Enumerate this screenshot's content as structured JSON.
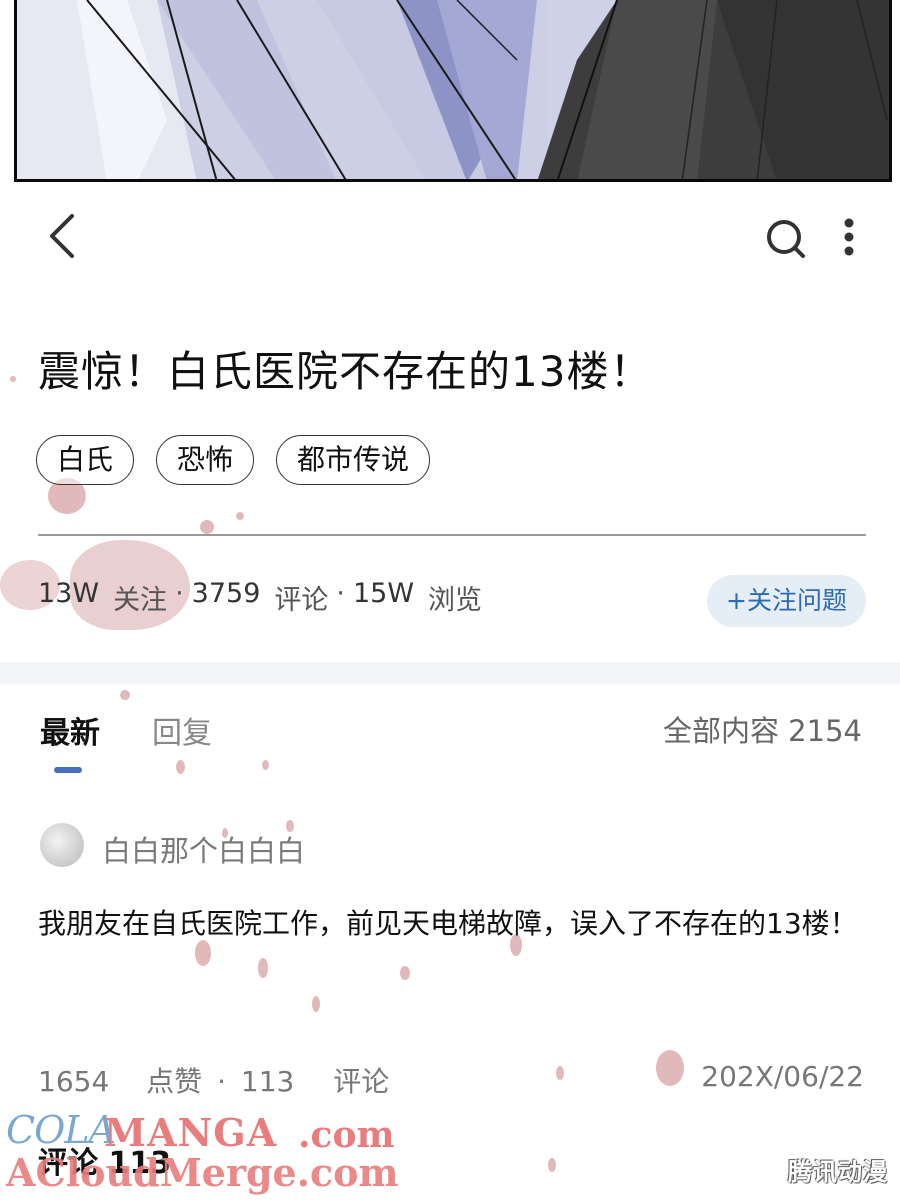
{
  "nav": {
    "back_icon": "chevron-left-icon",
    "search_icon": "search-icon",
    "more_icon": "more-vertical-icon"
  },
  "post": {
    "title": "震惊！白氏医院不存在的13楼！",
    "tags": [
      "白氏",
      "恐怖",
      "都市传说"
    ],
    "stats": {
      "followers": "13W",
      "followers_label": "关注",
      "sep1": "·",
      "comments": "3759",
      "comments_label": "评论",
      "sep2": "·",
      "views": "15W",
      "views_label": "浏览"
    },
    "follow_button": "+关注问题"
  },
  "tabs": {
    "latest": "最新",
    "reply": "回复",
    "all_content": "全部内容 2154"
  },
  "reply": {
    "username": "白白那个白白白",
    "content": "我朋友在自氏医院工作，前见天电梯故障，误入了不存在的13楼！",
    "likes": "1654",
    "likes_label": "点赞",
    "sep": "·",
    "comments": "113",
    "comments_label": "评论",
    "date": "202X/06/22"
  },
  "comments_heading": "评论 113",
  "watermark": {
    "line1a": "COLA",
    "line1b": "MANGA",
    "line1c": ".com",
    "line2": "ACloudMerge.com",
    "brand": "腾讯动漫"
  },
  "colors": {
    "accent": "#4a6fc0",
    "follow_bg": "#e5edf7",
    "follow_text": "#2b6bb0",
    "blood": "#d9a7a9"
  }
}
